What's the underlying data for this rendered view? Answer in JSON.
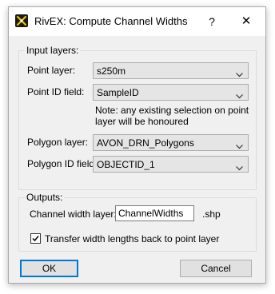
{
  "window": {
    "title": "RivEX: Compute Channel Widths",
    "help_glyph": "?",
    "close_glyph": "✕",
    "app_icon": "rivex-logo-icon"
  },
  "input_group": {
    "label": "Input layers:",
    "point_layer_label": "Point layer:",
    "point_layer_value": "s250m",
    "point_id_label": "Point ID field:",
    "point_id_value": "SampleID",
    "note_line1": "Note: any existing selection on point",
    "note_line2": "layer will be honoured",
    "polygon_layer_label": "Polygon layer:",
    "polygon_layer_value": "AVON_DRN_Polygons",
    "polygon_id_label": "Polygon ID field:",
    "polygon_id_value": "OBJECTID_1"
  },
  "output_group": {
    "label": "Outputs:",
    "channel_width_label": "Channel width layer:",
    "channel_width_value": "ChannelWidths",
    "extension": ".shp",
    "transfer_label": "Transfer width lengths back to point layer",
    "transfer_checked": true
  },
  "buttons": {
    "ok": "OK",
    "cancel": "Cancel"
  },
  "colors": {
    "dialog_bg": "#f0f0f0",
    "accent_border": "#0078d7"
  }
}
